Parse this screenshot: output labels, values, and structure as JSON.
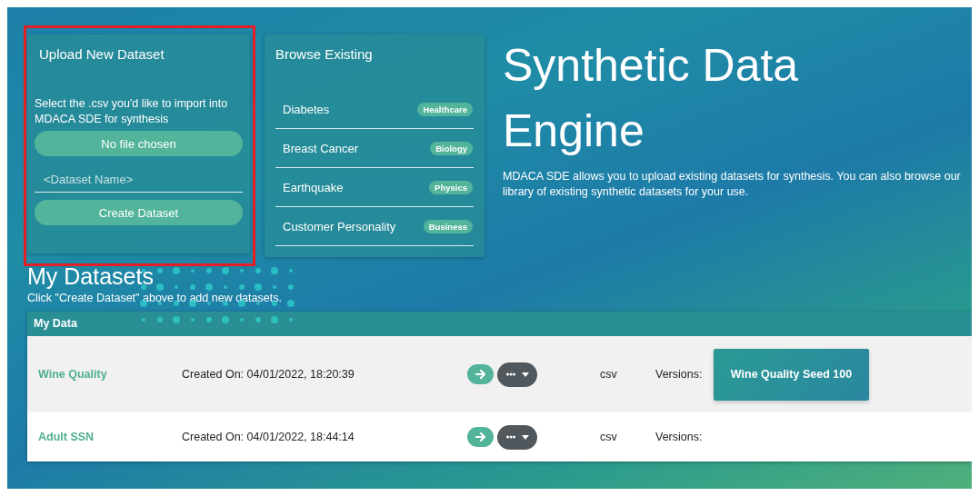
{
  "upload_card": {
    "title": "Upload New Dataset",
    "highlighted": true,
    "instructions": "Select the .csv you'd like to import into MDACA SDE for synthesis",
    "file_button": "No file chosen",
    "name_field": {
      "placeholder": "<Dataset Name>"
    },
    "create_button": "Create Dataset"
  },
  "browse_card": {
    "title": "Browse Existing",
    "items": [
      {
        "name": "Diabetes",
        "tag": "Healthcare"
      },
      {
        "name": "Breast Cancer",
        "tag": "Biology"
      },
      {
        "name": "Earthquake",
        "tag": "Physics"
      },
      {
        "name": "Customer Personality",
        "tag": "Business"
      }
    ]
  },
  "hero": {
    "title": "Synthetic Data Engine",
    "description": "MDACA SDE allows you to upload existing datasets for synthesis. You can also browse our library of existing synthetic datasets for your use."
  },
  "my_datasets": {
    "title": "My Datasets",
    "hint": "Click \"Create Dataset\" above to add new datasets.",
    "table": {
      "header": "My Data",
      "rows": [
        {
          "name": "Wine Quality",
          "created": "Created On: 04/01/2022, 18:20:39",
          "format": "csv",
          "versions_label": "Versions:",
          "versions": [
            "Wine Quality Seed 100"
          ]
        },
        {
          "name": "Adult SSN",
          "created": "Created On: 04/01/2022, 18:44:14",
          "format": "csv",
          "versions_label": "Versions:",
          "versions": []
        }
      ]
    }
  }
}
